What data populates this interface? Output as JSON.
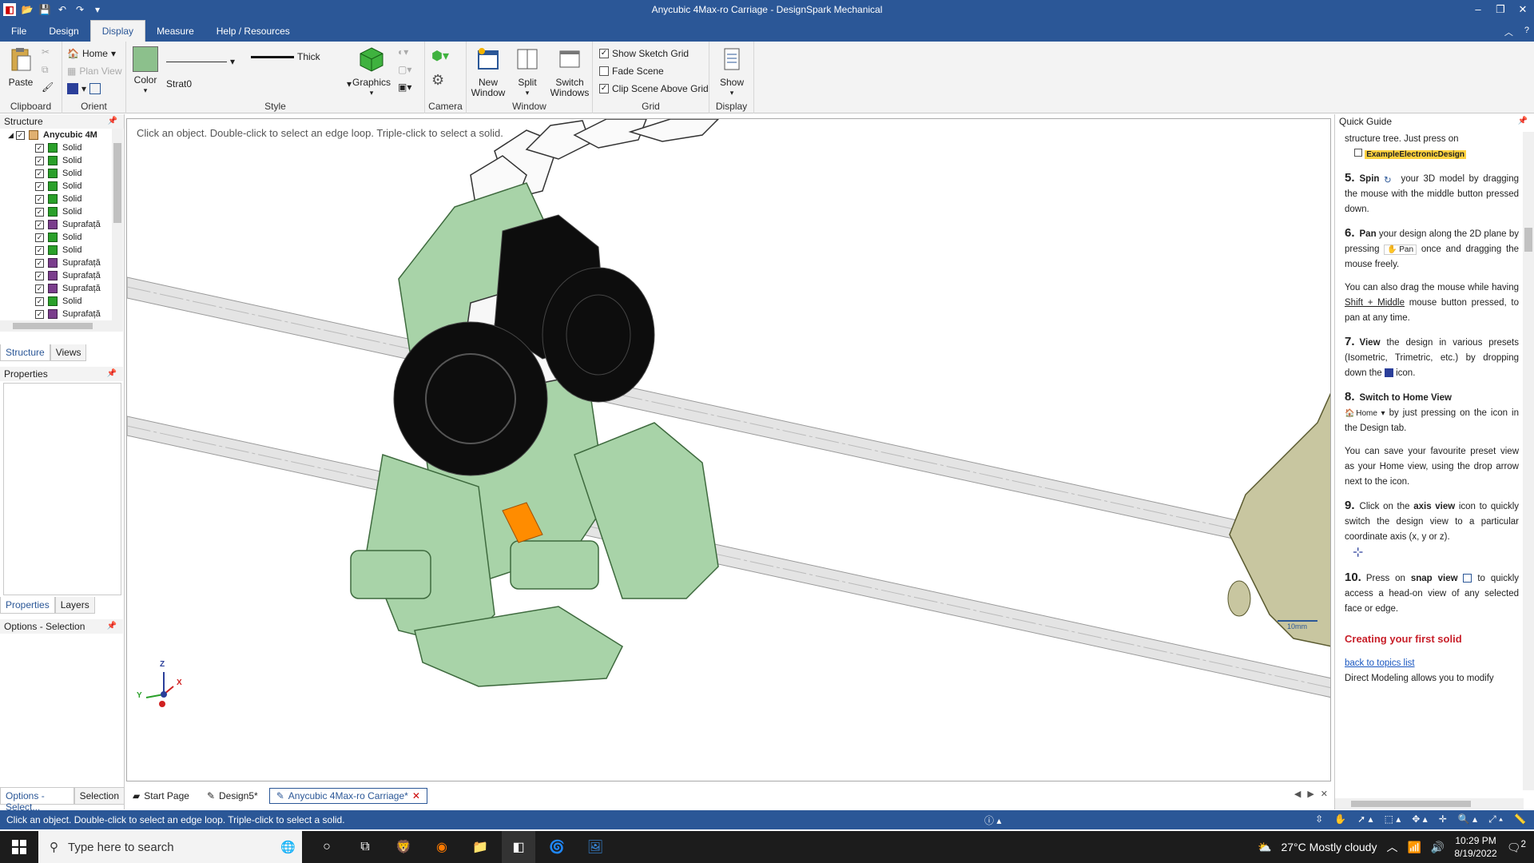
{
  "window": {
    "title": "Anycubic 4Max-ro Carriage - DesignSpark Mechanical"
  },
  "menu": {
    "tabs": [
      "File",
      "Design",
      "Display",
      "Measure",
      "Help / Resources"
    ],
    "active": "Display"
  },
  "ribbon": {
    "clipboard": {
      "paste": "Paste",
      "title": "Clipboard"
    },
    "orient": {
      "home": "Home",
      "plan_view": "Plan View",
      "title": "Orient"
    },
    "style": {
      "color": "Color",
      "layer": "Strat0",
      "line_weight": "Thick",
      "graphics": "Graphics",
      "title": "Style"
    },
    "camera": {
      "title": "Camera"
    },
    "window": {
      "new_window": "New Window",
      "split": "Split",
      "switch_windows": "Switch Windows",
      "title": "Window"
    },
    "grid": {
      "show_sketch_grid": "Show Sketch Grid",
      "fade_scene": "Fade Scene",
      "clip_scene": "Clip Scene Above Grid",
      "title": "Grid"
    },
    "display": {
      "show": "Show",
      "title": "Display"
    }
  },
  "structure": {
    "title": "Structure",
    "root": "Anycubic 4M",
    "items": [
      "Solid",
      "Solid",
      "Solid",
      "Solid",
      "Solid",
      "Solid",
      "Suprafață",
      "Solid",
      "Solid",
      "Suprafață",
      "Suprafață",
      "Suprafață",
      "Solid",
      "Suprafață"
    ],
    "tabs": [
      "Structure",
      "Views"
    ]
  },
  "properties": {
    "title": "Properties",
    "tabs": [
      "Properties",
      "Layers"
    ]
  },
  "options": {
    "title": "Options - Selection"
  },
  "viewport": {
    "hint": "Click an object. Double-click to select an edge loop. Triple-click to select a solid.",
    "scale_label": "10mm",
    "axes": {
      "z": "Z",
      "y": "Y",
      "x": "X"
    }
  },
  "doc_tabs": {
    "left": [
      "Options - Select...",
      "Selection"
    ],
    "items": [
      "Start Page",
      "Design5*",
      "Anycubic 4Max-ro Carriage*"
    ],
    "active": "Anycubic 4Max-ro Carriage*"
  },
  "guide": {
    "title": "Quick Guide",
    "intro": "structure tree. Just press on",
    "example": "ExampleElectronicDesign",
    "steps": [
      {
        "num": "5.",
        "label": "Spin",
        "text": "your 3D model by dragging the mouse with the middle button pressed down."
      },
      {
        "num": "6.",
        "label": "Pan",
        "text": "your design along the 2D plane by pressing",
        "badge": "Pan",
        "text2": "once and dragging the mouse freely."
      },
      {
        "num": "7.",
        "label": "View",
        "text": "the design in various presets (Isometric, Trimetric, etc.) by dropping down the",
        "text2": "icon."
      },
      {
        "num": "8.",
        "label": "Switch to Home View",
        "badge": "Home",
        "text": "by just pressing on the icon in the Design tab."
      },
      {
        "num": "9.",
        "label": "axis view",
        "text": "Click on the",
        "text2": "icon to quickly switch the design view to a particular coordinate axis (x, y or z)."
      },
      {
        "num": "10.",
        "label": "snap view",
        "text": "Press on",
        "text2": "to quickly access a head-on view of any selected face or edge."
      }
    ],
    "pan_note_pre": "You can also drag the mouse while having",
    "pan_note_key": "Shift + Middle",
    "pan_note_post": "mouse button pressed, to pan at any time.",
    "home_note": "You can save your favourite preset view as your Home view, using the drop arrow next to the icon.",
    "heading": "Creating your first solid",
    "back_link": "back to topics list",
    "tail": "Direct Modeling allows you to modify"
  },
  "status": {
    "text": "Click an object. Double-click to select an edge loop. Triple-click to select a solid."
  },
  "taskbar": {
    "search_placeholder": "Type here to search",
    "weather": "27°C  Mostly cloudy",
    "time": "10:29 PM",
    "date": "8/19/2022",
    "notif_count": "2"
  },
  "colors": {
    "accent": "#2b5797",
    "part_green": "#a8d3a8",
    "part_black": "#0d0d0d",
    "part_orange": "#ff8c00",
    "part_olive": "#c8c6a0",
    "rod": "#e4e4e4"
  }
}
